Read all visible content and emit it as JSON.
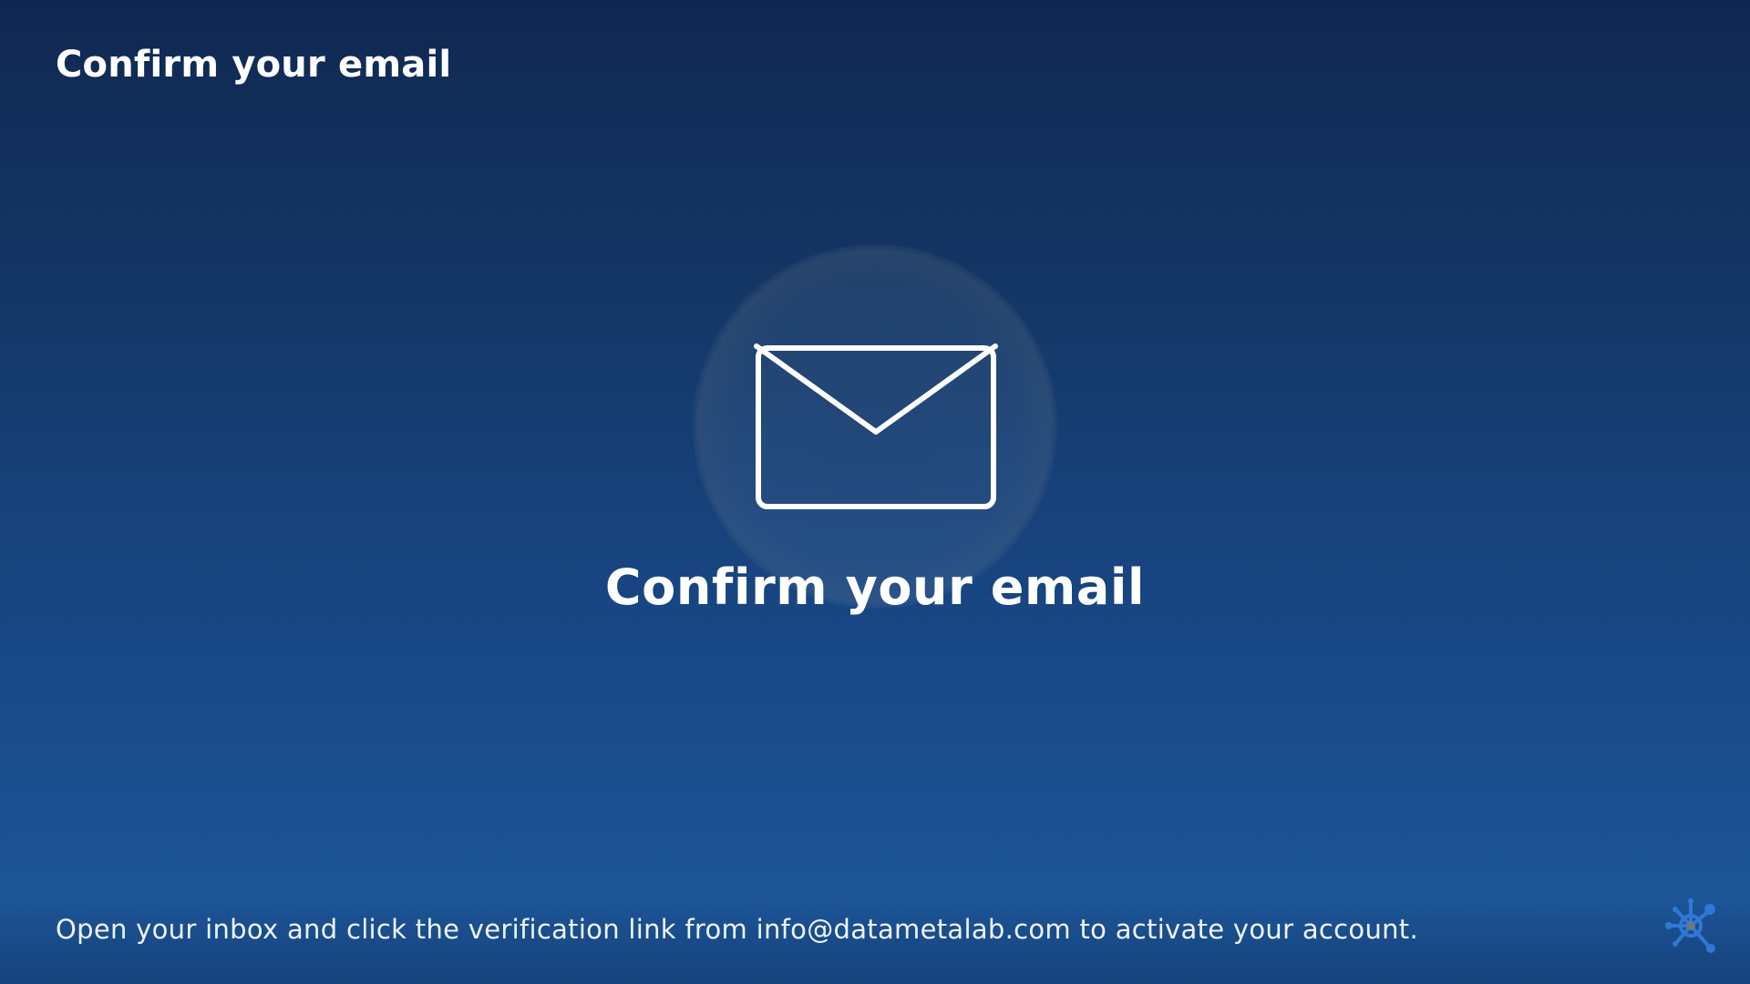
{
  "header": {
    "title": "Confirm your email"
  },
  "hero": {
    "icon": "envelope-icon",
    "title": "Confirm your email"
  },
  "footer": {
    "message": "Open your inbox and click the verification link from info@datametalab.com to activate your account.",
    "logo_icon": "molecule-network-logo-icon"
  },
  "colors": {
    "background_top": "#0f2852",
    "background_bottom": "#1c5597",
    "text": "#ffffff",
    "logo_accent": "#2f78d6"
  }
}
